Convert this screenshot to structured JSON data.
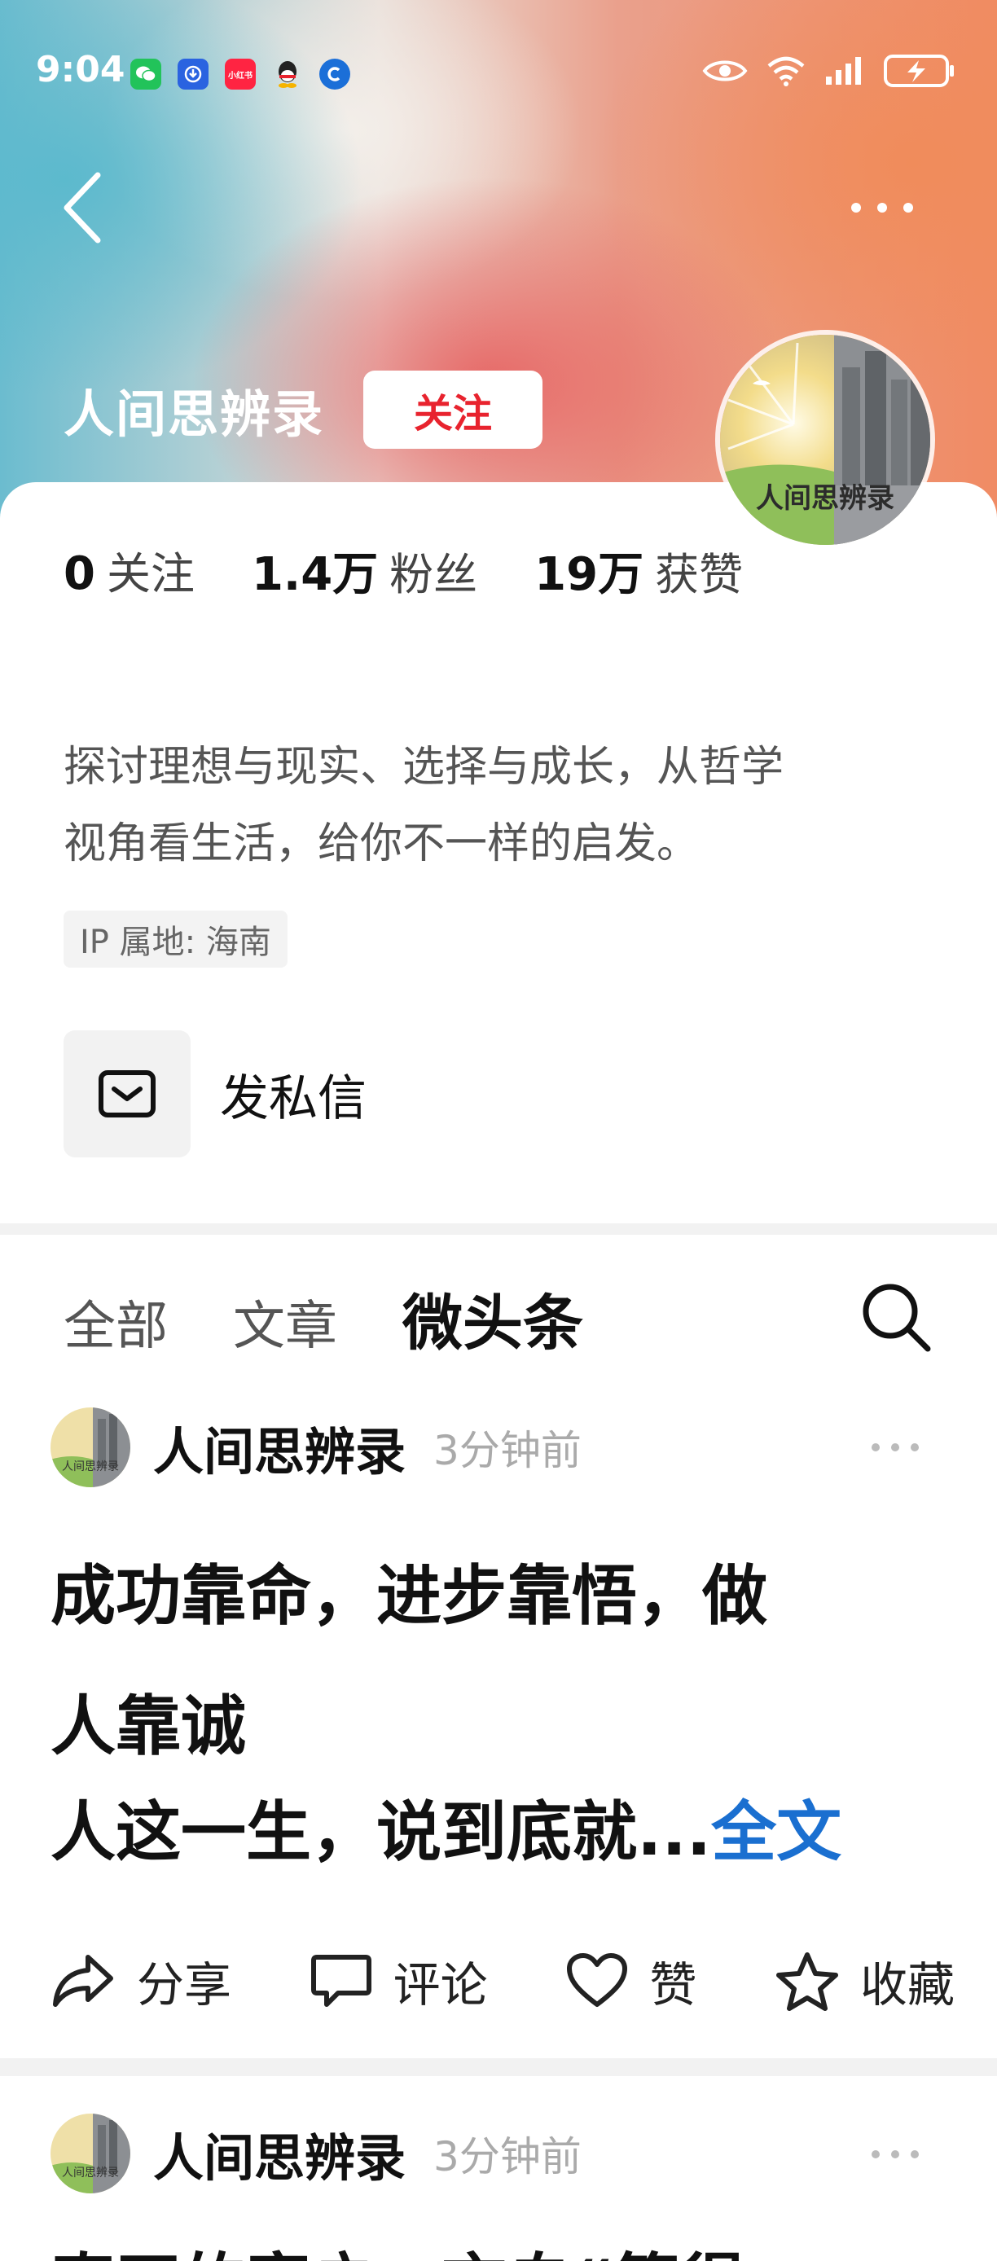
{
  "status_bar": {
    "time": "9:04",
    "notifications": [
      {
        "icon": "wechat-icon",
        "color": "#22c35a"
      },
      {
        "icon": "download-app-icon",
        "color": "#2a63e0"
      },
      {
        "icon": "xiaohongshu-icon",
        "color": "#ff2442",
        "label": "小红书"
      },
      {
        "icon": "qq-icon",
        "color": "#222222"
      },
      {
        "icon": "c-app-icon",
        "color": "#1b6fd8"
      }
    ],
    "indicators": [
      "eye-icon",
      "wifi-icon",
      "signal-icon",
      "battery-charging-icon"
    ]
  },
  "header": {
    "back_icon": "chevron-left-icon",
    "more_icon": "more-dots-icon"
  },
  "profile": {
    "name": "人间思辨录",
    "follow_label": "关注",
    "avatar_caption": "人间思辨录",
    "stats": [
      {
        "value": "0",
        "label": "关注"
      },
      {
        "value": "1.4万",
        "label": "粉丝"
      },
      {
        "value": "19万",
        "label": "获赞"
      }
    ],
    "bio_line1": "探讨理想与现实、选择与成长，从哲学",
    "bio_line2": "视角看生活，给你不一样的启发。",
    "ip_location": "IP 属地: 海南",
    "dm_label": "发私信"
  },
  "tabs": [
    {
      "label": "全部",
      "active": false
    },
    {
      "label": "文章",
      "active": false
    },
    {
      "label": "微头条",
      "active": true
    }
  ],
  "posts": [
    {
      "author": "人间思辨录",
      "time": "3分钟前",
      "title_line1": "成功靠命，进步靠悟，做",
      "title_line2": "人靠诚",
      "excerpt": "人这一生，说到底就...",
      "full_text_link": "全文",
      "actions": [
        {
          "icon": "share-icon",
          "label": "分享"
        },
        {
          "icon": "comment-icon",
          "label": "评论"
        },
        {
          "icon": "heart-icon",
          "label": "赞"
        },
        {
          "icon": "star-icon",
          "label": "收藏"
        }
      ]
    },
    {
      "author": "人间思辨录",
      "time": "3分钟前",
      "title_partial": "真正的富户，言自“篇得"
    }
  ],
  "colors": {
    "follow_red": "#e8232e",
    "link_blue": "#1a6fd0",
    "muted_text": "#aaaaaa"
  }
}
